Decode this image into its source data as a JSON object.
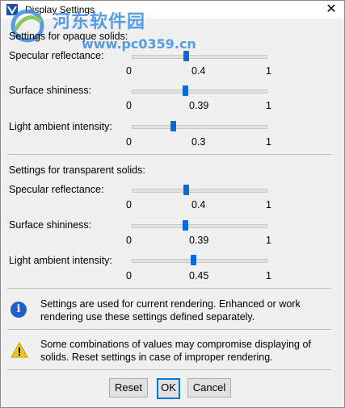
{
  "window": {
    "title": "Display Settings",
    "close_glyph": "✕"
  },
  "watermark": {
    "line1": "河东软件园",
    "line2": "www.pc0359.cn"
  },
  "opaque": {
    "section_title": "Settings for opaque solids:",
    "specular": {
      "label": "Specular reflectance:",
      "min": "0",
      "value": "0.4",
      "max": "1",
      "fraction": 0.4
    },
    "shininess": {
      "label": "Surface shininess:",
      "min": "0",
      "value": "0.39",
      "max": "1",
      "fraction": 0.39
    },
    "ambient": {
      "label": "Light ambient intensity:",
      "min": "0",
      "value": "0.3",
      "max": "1",
      "fraction": 0.3
    }
  },
  "transparent": {
    "section_title": "Settings for transparent solids:",
    "specular": {
      "label": "Specular reflectance:",
      "min": "0",
      "value": "0.4",
      "max": "1",
      "fraction": 0.4
    },
    "shininess": {
      "label": "Surface shininess:",
      "min": "0",
      "value": "0.39",
      "max": "1",
      "fraction": 0.39
    },
    "ambient": {
      "label": "Light ambient intensity:",
      "min": "0",
      "value": "0.45",
      "max": "1",
      "fraction": 0.45
    }
  },
  "info": {
    "icon": "info-icon",
    "line1": "Settings are used for current rendering. Enhanced or work",
    "line2": "rendering use these settings defined separately."
  },
  "warning": {
    "icon": "warning-icon",
    "line1": "Some combinations of values may compromise displaying of",
    "line2": "solids. Reset settings in case of improper rendering."
  },
  "buttons": {
    "reset": "Reset",
    "ok": "OK",
    "cancel": "Cancel"
  },
  "colors": {
    "slider_thumb": "#0a6ad6",
    "info_icon": "#1f5fc9",
    "warning_icon": "#f5c518"
  }
}
